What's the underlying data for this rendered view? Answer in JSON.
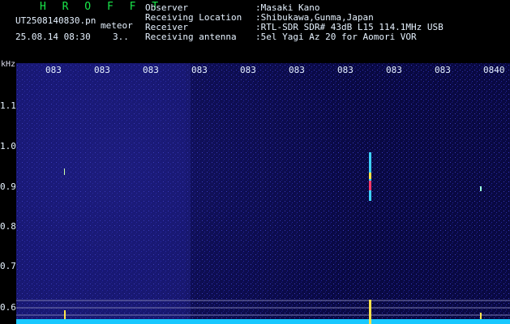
{
  "header": {
    "brand": "H R O F F T",
    "filename": "UT2508140830.pn",
    "mode": "meteor",
    "timestamp": "25.08.14 08:30",
    "count": "3..",
    "info": [
      {
        "label": "Observer",
        "value": ":Masaki Kano"
      },
      {
        "label": "Receiving Location",
        "value": ":Shibukawa,Gunma,Japan"
      },
      {
        "label": "Receiver",
        "value": ":RTL-SDR SDR# 43dB L15 114.1MHz USB"
      },
      {
        "label": "Receiving antenna",
        "value": ":5el Yagi Az 20 for Aomori VOR"
      }
    ]
  },
  "axes": {
    "y_unit": "kHz",
    "x_ticks": [
      "083",
      "083",
      "083",
      "083",
      "083",
      "083",
      "083",
      "083",
      "083",
      "0840"
    ],
    "y_ticks": [
      "1.1",
      "1.0",
      "0.9",
      "0.8",
      "0.7",
      "0.6"
    ]
  },
  "colors": {
    "background": "#000000",
    "spectrogram": "#0b0b56",
    "baseline": "#19c8ff",
    "brand": "#19e84a",
    "text": "#e6f2ff"
  }
}
